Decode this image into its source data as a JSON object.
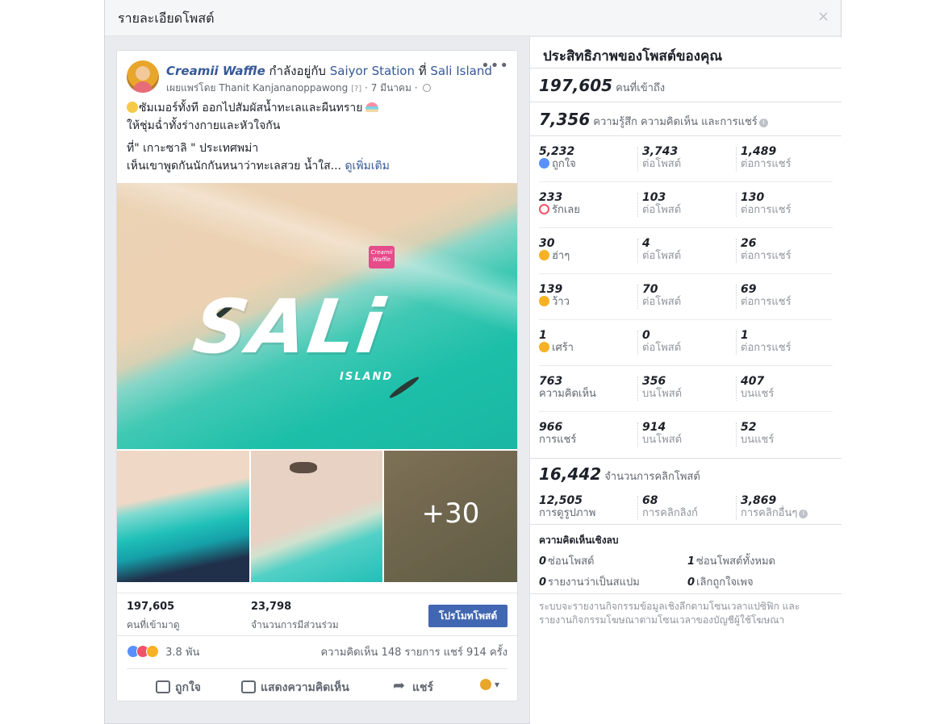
{
  "dialog": {
    "title": "รายละเอียดโพสต์",
    "close": "×"
  },
  "post": {
    "page_name": "Creamii Waffle",
    "with_text": "กำลังอยู่กับ",
    "with_link": "Saiyor Station",
    "at_text": "ที่",
    "place_link": "Sali Island",
    "published_by": "เผยแพร่โดย Thanit Kanjananoppawong",
    "help": "[?]",
    "sep": "·",
    "date": "7 มีนาคม",
    "more": "•••",
    "line1": "ซัมเมอร์ทั้งที ออกไปสัมผัสน้ำทะเลและผืนทราย",
    "line2": "ให้ชุ่มฉ่ำทั้งร่างกายและหัวใจกัน",
    "line3": "ที่\" เกาะซาลิ \" ประเทศพม่า",
    "line4": "เห็นเขาพูดกันนักกันหนาว่าทะเลสวย น้ำใส...",
    "see_more": "ดูเพิ่มเติม",
    "hero_text": "SALi",
    "hero_sub": "ISLAND",
    "logo_text": "Creamii Waffle",
    "more_photos": "+30"
  },
  "post_stats": {
    "reached": "197,605",
    "reached_label": "คนที่เข้ามาดู",
    "engaged": "23,798",
    "engaged_label": "จำนวนการมีส่วนร่วม",
    "promote": "โปรโมทโพสต์"
  },
  "reactions_bar": {
    "count": "3.8 พัน",
    "comments_shares": "ความคิดเห็น 148 รายการ  แชร์ 914 ครั้ง"
  },
  "actions": {
    "like": "ถูกใจ",
    "comment": "แสดงความคิดเห็น",
    "share": "แชร์"
  },
  "insights": {
    "title": "ประสิทธิภาพของโพสต์ของคุณ",
    "reach": "197,605",
    "reach_label": "คนที่เข้าถึง",
    "engagement": "7,356",
    "engagement_label": "ความรู้สึก ความคิดเห็น และการแชร์",
    "rows": [
      {
        "n1": "5,232",
        "l1": "ถูกใจ",
        "icon": "like",
        "n2": "3,743",
        "l2": "ต่อโพสต์",
        "n3": "1,489",
        "l3": "ต่อการแชร์"
      },
      {
        "n1": "233",
        "l1": "รักเลย",
        "icon": "love",
        "n2": "103",
        "l2": "ต่อโพสต์",
        "n3": "130",
        "l3": "ต่อการแชร์"
      },
      {
        "n1": "30",
        "l1": "ฮ่าๆ",
        "icon": "haha",
        "n2": "4",
        "l2": "ต่อโพสต์",
        "n3": "26",
        "l3": "ต่อการแชร์"
      },
      {
        "n1": "139",
        "l1": "ว้าว",
        "icon": "wow",
        "n2": "70",
        "l2": "ต่อโพสต์",
        "n3": "69",
        "l3": "ต่อการแชร์"
      },
      {
        "n1": "1",
        "l1": "เศร้า",
        "icon": "sad",
        "n2": "0",
        "l2": "ต่อโพสต์",
        "n3": "1",
        "l3": "ต่อการแชร์"
      },
      {
        "n1": "763",
        "l1": "ความคิดเห็น",
        "n2": "356",
        "l2": "บนโพสต์",
        "n3": "407",
        "l3": "บนแชร์"
      },
      {
        "n1": "966",
        "l1": "การแชร์",
        "n2": "914",
        "l2": "บนโพสต์",
        "n3": "52",
        "l3": "บนแชร์"
      }
    ],
    "clicks": "16,442",
    "clicks_label": "จำนวนการคลิกโพสต์",
    "click_cells": {
      "n1": "12,505",
      "l1": "การดูรูปภาพ",
      "n2": "68",
      "l2": "การคลิกลิงก์",
      "n3": "3,869",
      "l3": "การคลิกอื่นๆ"
    },
    "negative_title": "ความคิดเห็นเชิงลบ",
    "negative": {
      "hide_post_n": "0",
      "hide_post": "ซ่อนโพสต์",
      "hide_all_n": "1",
      "hide_all": "ซ่อนโพสต์ทั้งหมด",
      "spam_n": "0",
      "spam": "รายงานว่าเป็นสแปม",
      "unlike_n": "0",
      "unlike": "เลิกถูกใจเพจ"
    },
    "footnote": "ระบบจะรายงานกิจกรรมข้อมูลเชิงลึกตามโซนเวลาแปซิฟิก และรายงานกิจกรรมโฆษณาตามโซนเวลาของบัญชีผู้ใช้โฆษณา"
  }
}
